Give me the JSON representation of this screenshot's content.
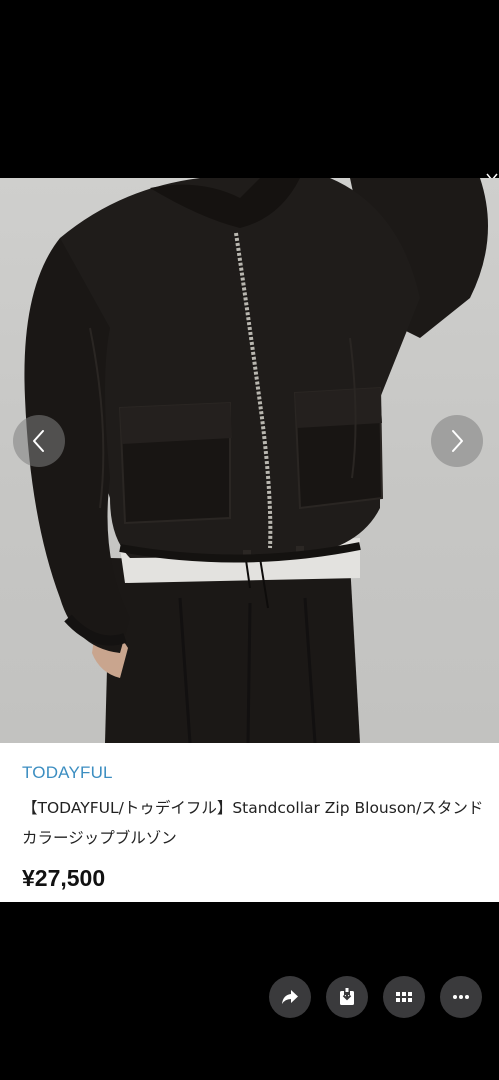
{
  "product": {
    "brand": "TODAYFUL",
    "title": "【TODAYFUL/トゥデイフル】Standcollar Zip Blouson/スタンドカラージップブルゾン",
    "price": "¥27,500"
  },
  "carousel": {
    "prev_icon": "chevron-left-icon",
    "next_icon": "chevron-right-icon"
  },
  "actions": [
    {
      "icon": "share-icon"
    },
    {
      "icon": "save-icon"
    },
    {
      "icon": "grid-icon"
    },
    {
      "icon": "more-icon"
    }
  ],
  "colors": {
    "brand_link": "#3c8ec1",
    "button_bg": "#3a3a3c",
    "background": "#000000"
  }
}
